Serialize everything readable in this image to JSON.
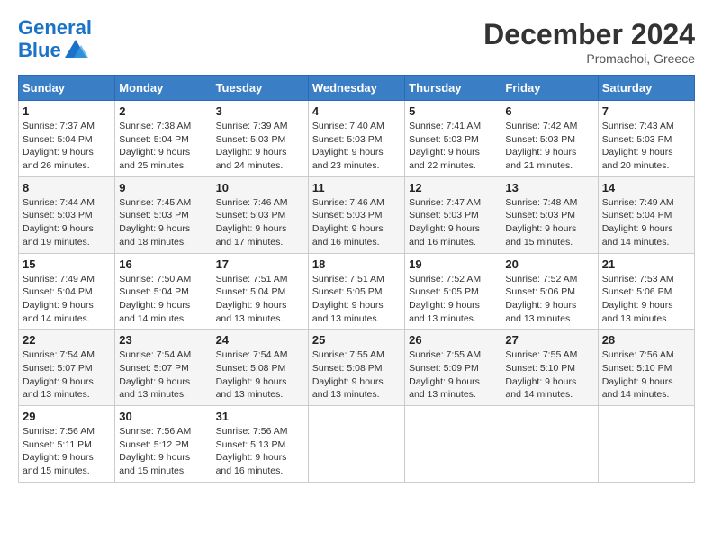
{
  "header": {
    "logo_general": "General",
    "logo_blue": "Blue",
    "month_year": "December 2024",
    "location": "Promachoi, Greece"
  },
  "weekdays": [
    "Sunday",
    "Monday",
    "Tuesday",
    "Wednesday",
    "Thursday",
    "Friday",
    "Saturday"
  ],
  "weeks": [
    [
      {
        "day": "1",
        "sunrise": "7:37 AM",
        "sunset": "5:04 PM",
        "daylight": "9 hours and 26 minutes."
      },
      {
        "day": "2",
        "sunrise": "7:38 AM",
        "sunset": "5:04 PM",
        "daylight": "9 hours and 25 minutes."
      },
      {
        "day": "3",
        "sunrise": "7:39 AM",
        "sunset": "5:03 PM",
        "daylight": "9 hours and 24 minutes."
      },
      {
        "day": "4",
        "sunrise": "7:40 AM",
        "sunset": "5:03 PM",
        "daylight": "9 hours and 23 minutes."
      },
      {
        "day": "5",
        "sunrise": "7:41 AM",
        "sunset": "5:03 PM",
        "daylight": "9 hours and 22 minutes."
      },
      {
        "day": "6",
        "sunrise": "7:42 AM",
        "sunset": "5:03 PM",
        "daylight": "9 hours and 21 minutes."
      },
      {
        "day": "7",
        "sunrise": "7:43 AM",
        "sunset": "5:03 PM",
        "daylight": "9 hours and 20 minutes."
      }
    ],
    [
      {
        "day": "8",
        "sunrise": "7:44 AM",
        "sunset": "5:03 PM",
        "daylight": "9 hours and 19 minutes."
      },
      {
        "day": "9",
        "sunrise": "7:45 AM",
        "sunset": "5:03 PM",
        "daylight": "9 hours and 18 minutes."
      },
      {
        "day": "10",
        "sunrise": "7:46 AM",
        "sunset": "5:03 PM",
        "daylight": "9 hours and 17 minutes."
      },
      {
        "day": "11",
        "sunrise": "7:46 AM",
        "sunset": "5:03 PM",
        "daylight": "9 hours and 16 minutes."
      },
      {
        "day": "12",
        "sunrise": "7:47 AM",
        "sunset": "5:03 PM",
        "daylight": "9 hours and 16 minutes."
      },
      {
        "day": "13",
        "sunrise": "7:48 AM",
        "sunset": "5:03 PM",
        "daylight": "9 hours and 15 minutes."
      },
      {
        "day": "14",
        "sunrise": "7:49 AM",
        "sunset": "5:04 PM",
        "daylight": "9 hours and 14 minutes."
      }
    ],
    [
      {
        "day": "15",
        "sunrise": "7:49 AM",
        "sunset": "5:04 PM",
        "daylight": "9 hours and 14 minutes."
      },
      {
        "day": "16",
        "sunrise": "7:50 AM",
        "sunset": "5:04 PM",
        "daylight": "9 hours and 14 minutes."
      },
      {
        "day": "17",
        "sunrise": "7:51 AM",
        "sunset": "5:04 PM",
        "daylight": "9 hours and 13 minutes."
      },
      {
        "day": "18",
        "sunrise": "7:51 AM",
        "sunset": "5:05 PM",
        "daylight": "9 hours and 13 minutes."
      },
      {
        "day": "19",
        "sunrise": "7:52 AM",
        "sunset": "5:05 PM",
        "daylight": "9 hours and 13 minutes."
      },
      {
        "day": "20",
        "sunrise": "7:52 AM",
        "sunset": "5:06 PM",
        "daylight": "9 hours and 13 minutes."
      },
      {
        "day": "21",
        "sunrise": "7:53 AM",
        "sunset": "5:06 PM",
        "daylight": "9 hours and 13 minutes."
      }
    ],
    [
      {
        "day": "22",
        "sunrise": "7:54 AM",
        "sunset": "5:07 PM",
        "daylight": "9 hours and 13 minutes."
      },
      {
        "day": "23",
        "sunrise": "7:54 AM",
        "sunset": "5:07 PM",
        "daylight": "9 hours and 13 minutes."
      },
      {
        "day": "24",
        "sunrise": "7:54 AM",
        "sunset": "5:08 PM",
        "daylight": "9 hours and 13 minutes."
      },
      {
        "day": "25",
        "sunrise": "7:55 AM",
        "sunset": "5:08 PM",
        "daylight": "9 hours and 13 minutes."
      },
      {
        "day": "26",
        "sunrise": "7:55 AM",
        "sunset": "5:09 PM",
        "daylight": "9 hours and 13 minutes."
      },
      {
        "day": "27",
        "sunrise": "7:55 AM",
        "sunset": "5:10 PM",
        "daylight": "9 hours and 14 minutes."
      },
      {
        "day": "28",
        "sunrise": "7:56 AM",
        "sunset": "5:10 PM",
        "daylight": "9 hours and 14 minutes."
      }
    ],
    [
      {
        "day": "29",
        "sunrise": "7:56 AM",
        "sunset": "5:11 PM",
        "daylight": "9 hours and 15 minutes."
      },
      {
        "day": "30",
        "sunrise": "7:56 AM",
        "sunset": "5:12 PM",
        "daylight": "9 hours and 15 minutes."
      },
      {
        "day": "31",
        "sunrise": "7:56 AM",
        "sunset": "5:13 PM",
        "daylight": "9 hours and 16 minutes."
      },
      null,
      null,
      null,
      null
    ]
  ],
  "labels": {
    "sunrise": "Sunrise:",
    "sunset": "Sunset:",
    "daylight": "Daylight:"
  }
}
